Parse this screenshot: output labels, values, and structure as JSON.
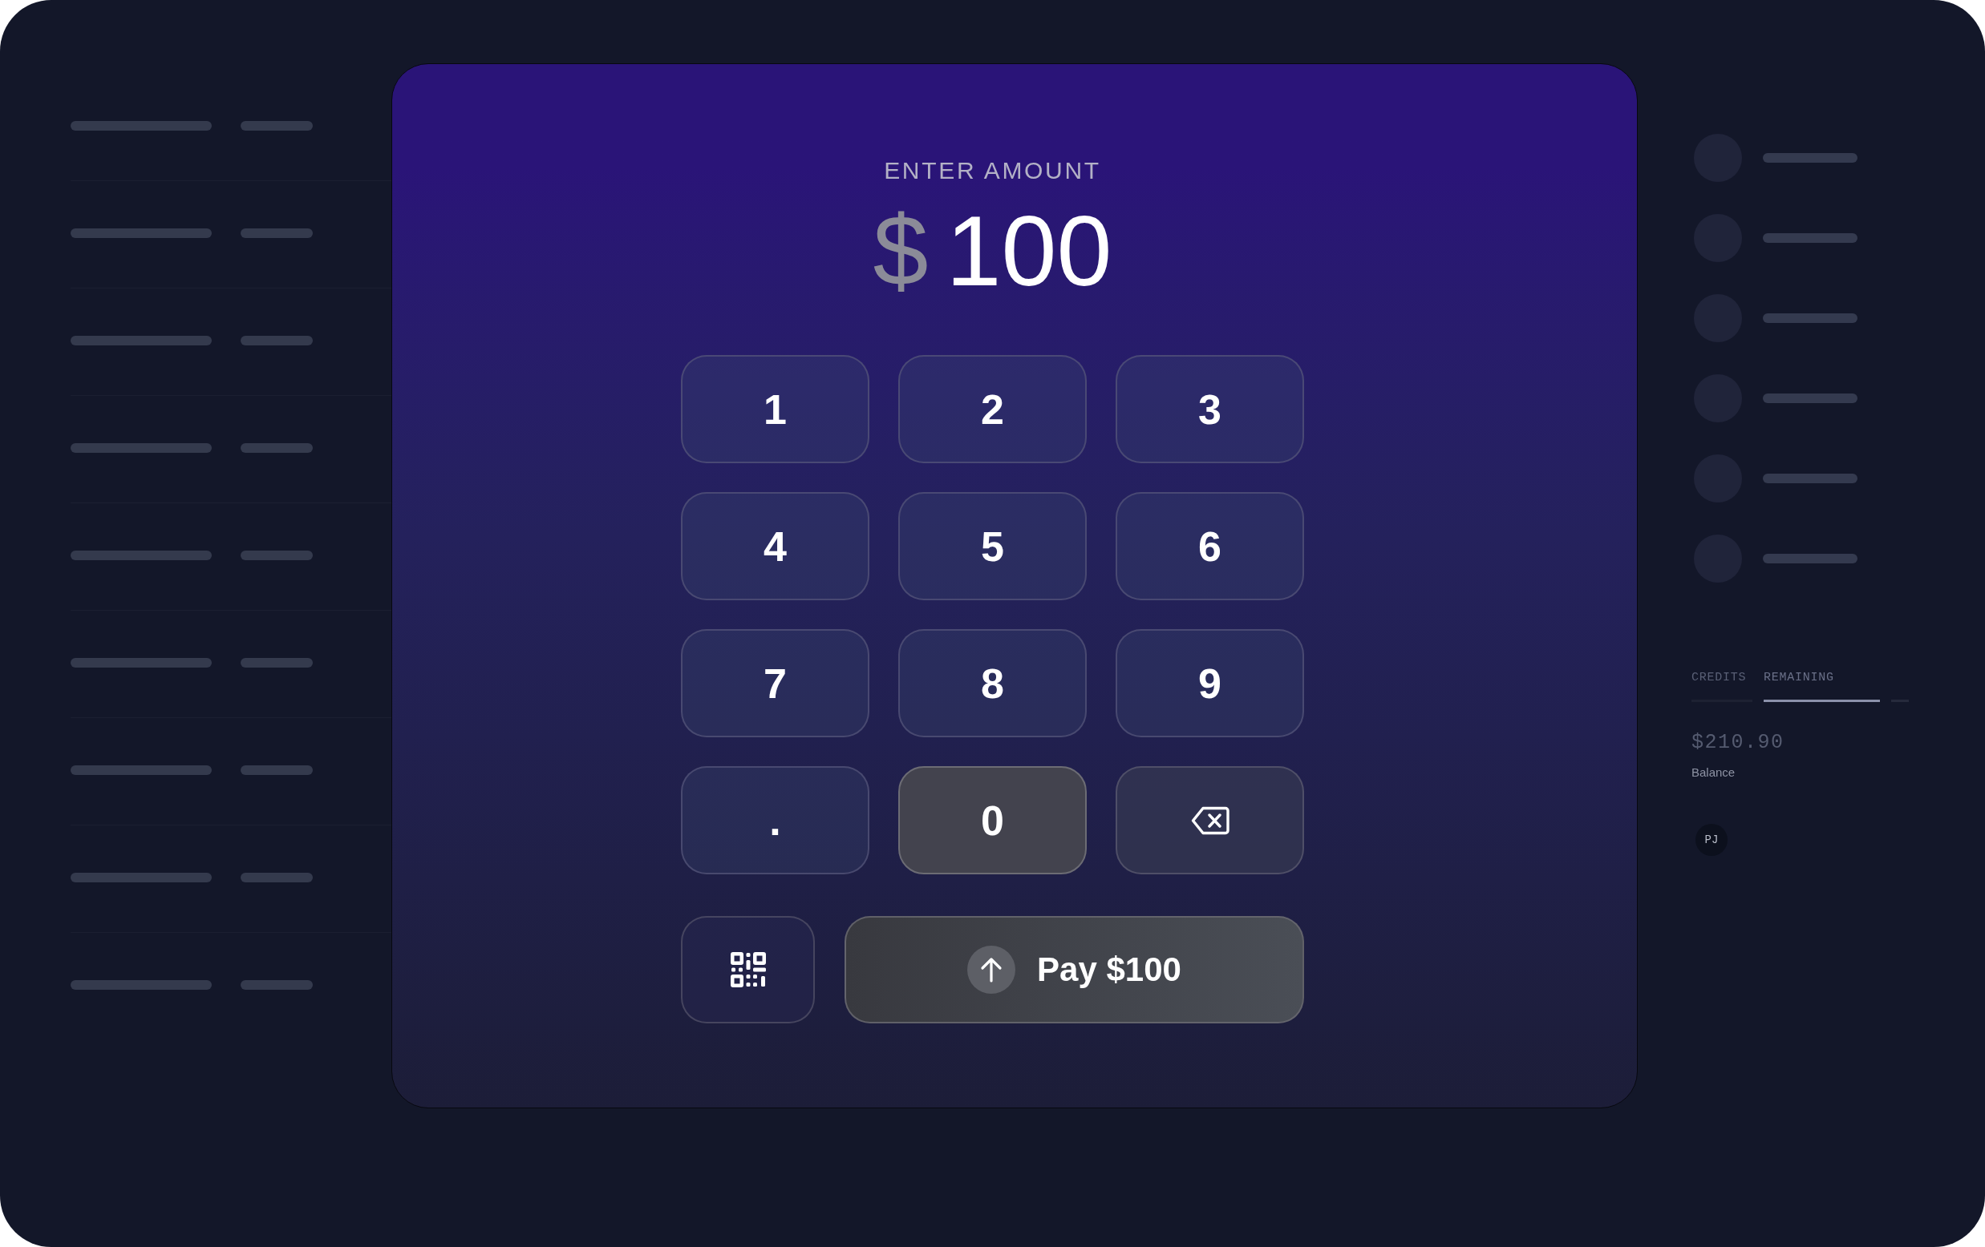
{
  "left_panel": {
    "rows": [
      {
        "kind": "skeleton"
      },
      {
        "kind": "skeleton"
      },
      {
        "kind": "skeleton"
      },
      {
        "kind": "skeleton"
      },
      {
        "kind": "skeleton"
      },
      {
        "kind": "skeleton"
      },
      {
        "kind": "skeleton"
      },
      {
        "kind": "skeleton"
      },
      {
        "kind": "skeleton"
      }
    ]
  },
  "amount_entry": {
    "label": "ENTER AMOUNT",
    "currency": "$",
    "amount": "100"
  },
  "keypad": {
    "keys": [
      {
        "kind": "digit",
        "label": "1",
        "pressed": false
      },
      {
        "kind": "digit",
        "label": "2",
        "pressed": false
      },
      {
        "kind": "digit",
        "label": "3",
        "pressed": false
      },
      {
        "kind": "digit",
        "label": "4",
        "pressed": false
      },
      {
        "kind": "digit",
        "label": "5",
        "pressed": false
      },
      {
        "kind": "digit",
        "label": "6",
        "pressed": false
      },
      {
        "kind": "digit",
        "label": "7",
        "pressed": false
      },
      {
        "kind": "digit",
        "label": "8",
        "pressed": false
      },
      {
        "kind": "digit",
        "label": "9",
        "pressed": false
      },
      {
        "kind": "decimal",
        "label": ".",
        "pressed": false
      },
      {
        "kind": "digit",
        "label": "0",
        "pressed": true
      },
      {
        "kind": "backspace",
        "pressed": false
      }
    ]
  },
  "actions": [
    {
      "kind": "qr_scan"
    },
    {
      "kind": "pay",
      "label": "Pay $100"
    }
  ],
  "right_panel": {
    "list": [
      {
        "kind": "skeleton"
      },
      {
        "kind": "skeleton"
      },
      {
        "kind": "skeleton"
      },
      {
        "kind": "skeleton"
      },
      {
        "kind": "skeleton"
      },
      {
        "kind": "skeleton"
      }
    ],
    "tabs": [
      {
        "label": "CREDITS",
        "selected": false
      },
      {
        "label": "REMAINING",
        "selected": true
      }
    ],
    "balance": {
      "value": "$210.90",
      "label": "Balance"
    },
    "user_initials": "PJ"
  }
}
